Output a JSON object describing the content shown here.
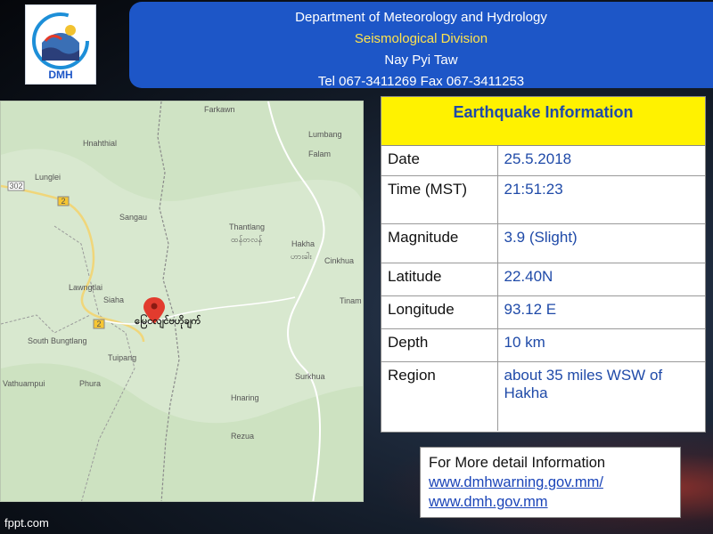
{
  "header": {
    "line1": "Department of Meteorology and Hydrology",
    "line2": "Seismological Division",
    "line3": "Nay Pyi Taw",
    "line4": "Tel 067-3411269 Fax 067-3411253"
  },
  "logo": {
    "text": "DMH"
  },
  "map": {
    "epicenter_label": "မြေငလျင်ဗဟိုချက်",
    "places": [
      "Farkawn",
      "Lumbang",
      "Hnahthial",
      "Falam",
      "Lunglei",
      "Sangau",
      "Thantlang",
      "ထန်တလန်",
      "Hakha",
      "ဟားခါး",
      "Cinkhua",
      "Lawngtlai",
      "Siaha",
      "Tinam",
      "South Bungtlang",
      "Tuipang",
      "Vathuampui",
      "Phura",
      "Surkhua",
      "Hnaring",
      "Rezua"
    ],
    "road_labels": [
      "302",
      "2",
      "2"
    ]
  },
  "info": {
    "title": "Earthquake Information",
    "rows": [
      {
        "label": "Date",
        "value": "25.5.2018"
      },
      {
        "label": "Time (MST)",
        "value": "21:51:23"
      },
      {
        "label": "Magnitude",
        "value": "3.9 (Slight)"
      },
      {
        "label": "Latitude",
        "value": "22.40N"
      },
      {
        "label": "Longitude",
        "value": "93.12 E"
      },
      {
        "label": "Depth",
        "value": "10 km"
      },
      {
        "label": "Region",
        "value": "about 35 miles WSW of Hakha"
      }
    ]
  },
  "detail": {
    "heading": "For More detail Information",
    "link1": "www.dmhwarning.gov.mm/",
    "link2": "www.dmh.gov.mm"
  },
  "footer": {
    "text": "fppt.com"
  },
  "colors": {
    "header_bg": "#1d56c7",
    "title_bg": "#fff200",
    "value_text": "#1f4aa8",
    "link": "#1a44b8"
  }
}
